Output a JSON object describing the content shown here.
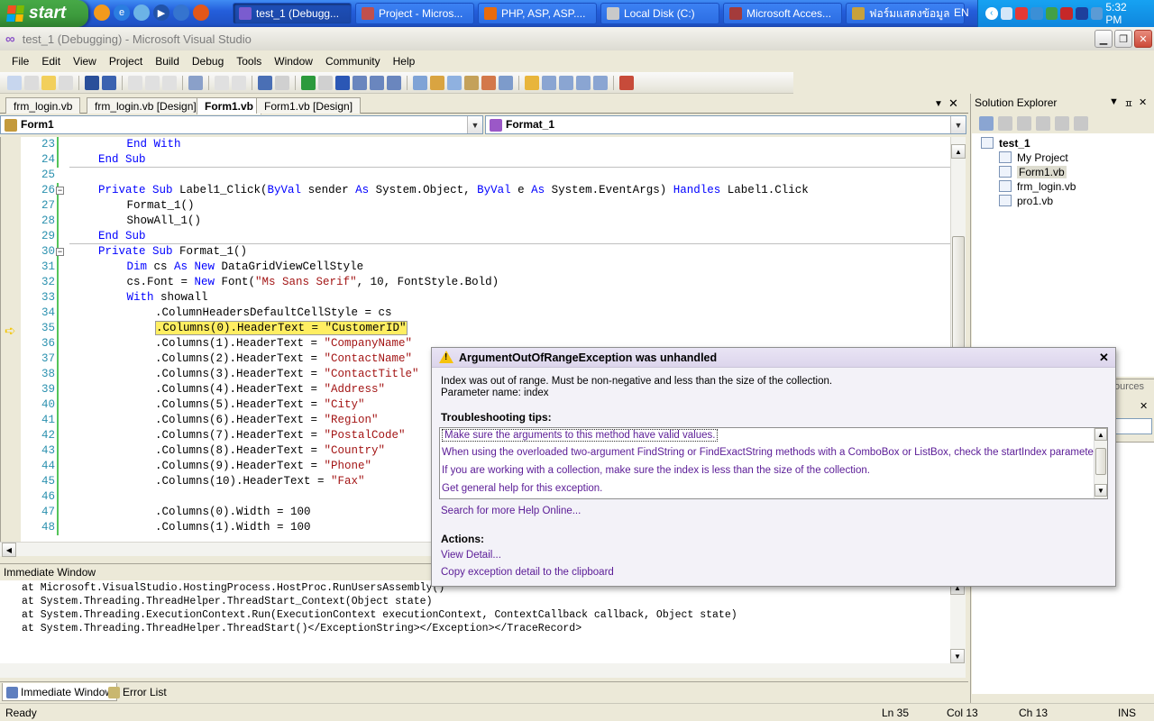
{
  "taskbar": {
    "start_label": "start",
    "tasks": [
      {
        "label": "test_1 (Debugg...",
        "color": "#7a5ccf"
      },
      {
        "label": "Project - Micros...",
        "color": "#c0504d"
      },
      {
        "label": "PHP, ASP, ASP....",
        "color": "#e96b0c"
      },
      {
        "label": "Local Disk (C:)",
        "color": "#c9c9c9"
      },
      {
        "label": "Microsoft Acces...",
        "color": "#a43b3b"
      },
      {
        "label": "ฟอร์มแสดงข้อมูล",
        "color": "#c8a13c"
      }
    ],
    "language": "EN",
    "clock": "5:32 PM"
  },
  "window": {
    "title": "test_1 (Debugging) - Microsoft Visual Studio"
  },
  "menu": [
    "File",
    "Edit",
    "View",
    "Project",
    "Build",
    "Debug",
    "Tools",
    "Window",
    "Community",
    "Help"
  ],
  "doc_tabs": [
    {
      "label": "frm_login.vb",
      "active": false
    },
    {
      "label": "frm_login.vb [Design]",
      "active": false
    },
    {
      "label": "Form1.vb",
      "active": true
    },
    {
      "label": "Form1.vb [Design]",
      "active": false
    }
  ],
  "combos": {
    "class": "Form1",
    "method": "Format_1"
  },
  "code_lines": [
    {
      "n": "23",
      "indent": 2,
      "tokens": [
        [
          "kw",
          "End With"
        ]
      ]
    },
    {
      "n": "24",
      "indent": 1,
      "tokens": [
        [
          "kw",
          "End Sub"
        ]
      ]
    },
    {
      "n": "25",
      "indent": 0,
      "tokens": []
    },
    {
      "n": "26",
      "indent": 1,
      "tokens": [
        [
          "kw",
          "Private Sub "
        ],
        [
          "t",
          "Label1_Click("
        ],
        [
          "kw",
          "ByVal "
        ],
        [
          "t",
          "sender "
        ],
        [
          "kw",
          "As "
        ],
        [
          "t",
          "System.Object, "
        ],
        [
          "kw",
          "ByVal "
        ],
        [
          "t",
          "e "
        ],
        [
          "kw",
          "As "
        ],
        [
          "t",
          "System.EventArgs) "
        ],
        [
          "kw",
          "Handles "
        ],
        [
          "t",
          "Label1.Click"
        ]
      ]
    },
    {
      "n": "27",
      "indent": 2,
      "tokens": [
        [
          "t",
          "Format_1()"
        ]
      ]
    },
    {
      "n": "28",
      "indent": 2,
      "tokens": [
        [
          "t",
          "ShowAll_1()"
        ]
      ]
    },
    {
      "n": "29",
      "indent": 1,
      "tokens": [
        [
          "kw",
          "End Sub"
        ]
      ]
    },
    {
      "n": "30",
      "indent": 1,
      "tokens": [
        [
          "kw",
          "Private Sub "
        ],
        [
          "t",
          "Format_1()"
        ]
      ]
    },
    {
      "n": "31",
      "indent": 2,
      "tokens": [
        [
          "kw",
          "Dim "
        ],
        [
          "t",
          "cs "
        ],
        [
          "kw",
          "As New "
        ],
        [
          "t",
          "DataGridViewCellStyle"
        ]
      ]
    },
    {
      "n": "32",
      "indent": 2,
      "tokens": [
        [
          "t",
          "cs.Font = "
        ],
        [
          "kw",
          "New "
        ],
        [
          "t",
          "Font("
        ],
        [
          "str",
          "\"Ms Sans Serif\""
        ],
        [
          "t",
          ", 10, FontStyle.Bold)"
        ]
      ]
    },
    {
      "n": "33",
      "indent": 2,
      "tokens": [
        [
          "kw",
          "With "
        ],
        [
          "t",
          "showall"
        ]
      ]
    },
    {
      "n": "34",
      "indent": 3,
      "tokens": [
        [
          "t",
          ".ColumnHeadersDefaultCellStyle = cs"
        ]
      ]
    },
    {
      "n": "35",
      "indent": 3,
      "tokens": [
        [
          "hl",
          ".Columns(0).HeaderText = \"CustomerID\""
        ]
      ]
    },
    {
      "n": "36",
      "indent": 3,
      "tokens": [
        [
          "t",
          ".Columns(1).HeaderText = "
        ],
        [
          "str",
          "\"CompanyName\""
        ]
      ]
    },
    {
      "n": "37",
      "indent": 3,
      "tokens": [
        [
          "t",
          ".Columns(2).HeaderText = "
        ],
        [
          "str",
          "\"ContactName\""
        ]
      ]
    },
    {
      "n": "38",
      "indent": 3,
      "tokens": [
        [
          "t",
          ".Columns(3).HeaderText = "
        ],
        [
          "str",
          "\"ContactTitle\""
        ]
      ]
    },
    {
      "n": "39",
      "indent": 3,
      "tokens": [
        [
          "t",
          ".Columns(4).HeaderText = "
        ],
        [
          "str",
          "\"Address\""
        ]
      ]
    },
    {
      "n": "40",
      "indent": 3,
      "tokens": [
        [
          "t",
          ".Columns(5).HeaderText = "
        ],
        [
          "str",
          "\"City\""
        ]
      ]
    },
    {
      "n": "41",
      "indent": 3,
      "tokens": [
        [
          "t",
          ".Columns(6).HeaderText = "
        ],
        [
          "str",
          "\"Region\""
        ]
      ]
    },
    {
      "n": "42",
      "indent": 3,
      "tokens": [
        [
          "t",
          ".Columns(7).HeaderText = "
        ],
        [
          "str",
          "\"PostalCode\""
        ]
      ]
    },
    {
      "n": "43",
      "indent": 3,
      "tokens": [
        [
          "t",
          ".Columns(8).HeaderText = "
        ],
        [
          "str",
          "\"Country\""
        ]
      ]
    },
    {
      "n": "44",
      "indent": 3,
      "tokens": [
        [
          "t",
          ".Columns(9).HeaderText = "
        ],
        [
          "str",
          "\"Phone\""
        ]
      ]
    },
    {
      "n": "45",
      "indent": 3,
      "tokens": [
        [
          "t",
          ".Columns(10).HeaderText = "
        ],
        [
          "str",
          "\"Fax\""
        ]
      ]
    },
    {
      "n": "46",
      "indent": 0,
      "tokens": []
    },
    {
      "n": "47",
      "indent": 3,
      "tokens": [
        [
          "t",
          ".Columns(0).Width = 100"
        ]
      ]
    },
    {
      "n": "48",
      "indent": 3,
      "tokens": [
        [
          "t",
          ".Columns(1).Width = 100"
        ]
      ]
    }
  ],
  "immediate": {
    "title": "Immediate Window",
    "lines": [
      "at Microsoft.VisualStudio.HostingProcess.HostProc.RunUsersAssembly()",
      "at System.Threading.ThreadHelper.ThreadStart_Context(Object state)",
      "at System.Threading.ExecutionContext.Run(ExecutionContext executionContext, ContextCallback callback, Object state)",
      "at System.Threading.ThreadHelper.ThreadStart()</ExceptionString></Exception></TraceRecord>"
    ]
  },
  "bottom_tabs": {
    "immediate": "Immediate Window",
    "errors": "Error List"
  },
  "status": {
    "state": "Ready",
    "ln": "Ln 35",
    "col": "Col 13",
    "ch": "Ch 13",
    "mode": "INS"
  },
  "solution_explorer": {
    "title": "Solution Explorer",
    "root": "test_1",
    "items": [
      "My Project",
      "Form1.vb",
      "frm_login.vb",
      "pro1.vb"
    ],
    "lower_tab": "ources"
  },
  "exception": {
    "title": "ArgumentOutOfRangeException was unhandled",
    "message1": "Index was out of range. Must be non-negative and less than the size of the collection.",
    "message2": "Parameter name: index",
    "tips_heading": "Troubleshooting tips:",
    "tips": [
      "Make sure the arguments to this method have valid values.",
      "When using the overloaded two-argument FindString or FindExactString methods with a ComboBox or ListBox, check the startIndex parameter.",
      "If you are working with a collection, make sure the index is less than the size of the collection.",
      "Get general help for this exception."
    ],
    "search_link": "Search for more Help Online...",
    "actions_heading": "Actions:",
    "actions": [
      "View Detail...",
      "Copy exception detail to the clipboard"
    ]
  }
}
